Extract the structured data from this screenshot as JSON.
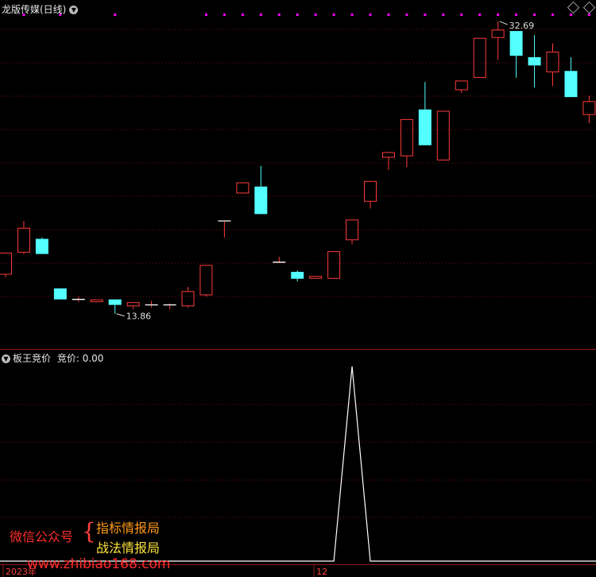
{
  "header": {
    "main_title": "龙版传媒(日线)",
    "sub_title": "板王竞价",
    "sub_value_label": "竞价: 0.00"
  },
  "colors": {
    "up": "#ff3a3a",
    "down": "#54ffff",
    "grid": "#7a1010",
    "marker": "#ff00ff",
    "line": "#ffffff"
  },
  "chart_data": [
    {
      "type": "candlestick",
      "title": "龙版传媒(日线)",
      "ylim": [
        12.4,
        35.5
      ],
      "grid": true,
      "annotations": [
        {
          "label": "13.86",
          "candle_index": 6
        },
        {
          "label": "32.69",
          "candle_index": 27
        }
      ],
      "marker_candle_indices": [
        1,
        3,
        6,
        11,
        12,
        13,
        14,
        15,
        16,
        17,
        18,
        19,
        20,
        21,
        22,
        23,
        24,
        25,
        26,
        27,
        28,
        29,
        30,
        31,
        32
      ],
      "candles": [
        {
          "o": 16.7,
          "c": 18.3,
          "h": 18.3,
          "l": 16.5
        },
        {
          "o": 18.3,
          "c": 20.1,
          "h": 20.6,
          "l": 18.2
        },
        {
          "o": 19.3,
          "c": 18.2,
          "h": 19.4,
          "l": 18.2
        },
        {
          "o": 15.7,
          "c": 14.9,
          "h": 15.7,
          "l": 14.9
        },
        {
          "o": 14.9,
          "c": 14.9,
          "h": 15.1,
          "l": 14.7
        },
        {
          "o": 14.7,
          "c": 14.9,
          "h": 14.9,
          "l": 14.7
        },
        {
          "o": 14.9,
          "c": 14.5,
          "h": 14.9,
          "l": 13.86
        },
        {
          "o": 14.4,
          "c": 14.7,
          "h": 14.7,
          "l": 14.2
        },
        {
          "o": 14.5,
          "c": 14.5,
          "h": 14.8,
          "l": 14.3
        },
        {
          "o": 14.5,
          "c": 14.5,
          "h": 14.6,
          "l": 14.2
        },
        {
          "o": 14.4,
          "c": 15.5,
          "h": 15.8,
          "l": 14.3
        },
        {
          "o": 15.2,
          "c": 17.4,
          "h": 17.4,
          "l": 15.1
        },
        {
          "o": 20.6,
          "c": 20.6,
          "h": 20.6,
          "l": 19.4
        },
        {
          "o": 22.6,
          "c": 23.4,
          "h": 23.4,
          "l": 22.6
        },
        {
          "o": 23.1,
          "c": 21.1,
          "h": 24.6,
          "l": 21.1
        },
        {
          "o": 17.6,
          "c": 17.6,
          "h": 18.0,
          "l": 17.6
        },
        {
          "o": 16.9,
          "c": 16.4,
          "h": 17.0,
          "l": 16.2
        },
        {
          "o": 16.4,
          "c": 16.6,
          "h": 16.6,
          "l": 16.4
        },
        {
          "o": 16.4,
          "c": 18.4,
          "h": 18.4,
          "l": 16.4
        },
        {
          "o": 19.2,
          "c": 20.7,
          "h": 20.7,
          "l": 18.9
        },
        {
          "o": 22.0,
          "c": 23.5,
          "h": 23.5,
          "l": 21.5
        },
        {
          "o": 25.2,
          "c": 25.6,
          "h": 25.6,
          "l": 24.3
        },
        {
          "o": 25.3,
          "c": 28.0,
          "h": 28.0,
          "l": 24.5
        },
        {
          "o": 28.7,
          "c": 26.1,
          "h": 30.7,
          "l": 26.1
        },
        {
          "o": 25.0,
          "c": 28.6,
          "h": 28.6,
          "l": 25.0
        },
        {
          "o": 30.1,
          "c": 30.8,
          "h": 30.8,
          "l": 29.9
        },
        {
          "o": 31.0,
          "c": 33.9,
          "h": 33.9,
          "l": 31.0
        },
        {
          "o": 33.9,
          "c": 34.5,
          "h": 35.1,
          "l": 32.3
        },
        {
          "o": 34.4,
          "c": 32.6,
          "h": 34.2,
          "l": 31.0
        },
        {
          "o": 32.5,
          "c": 31.9,
          "h": 34.1,
          "l": 30.3
        },
        {
          "o": 31.4,
          "c": 32.9,
          "h": 33.5,
          "l": 30.4
        },
        {
          "o": 31.5,
          "c": 29.6,
          "h": 32.5,
          "l": 29.6
        },
        {
          "o": 28.3,
          "c": 29.3,
          "h": 29.7,
          "l": 27.7
        }
      ]
    },
    {
      "type": "line",
      "title": "板王竞价",
      "series_label": "竞价",
      "current_value": "0.00",
      "ylim": [
        0,
        100
      ],
      "values": [
        0,
        0,
        0,
        0,
        0,
        0,
        0,
        0,
        0,
        0,
        0,
        0,
        0,
        0,
        0,
        0,
        0,
        0,
        0,
        100,
        0,
        0,
        0,
        0,
        0,
        0,
        0,
        0,
        0,
        0,
        0,
        0,
        0
      ],
      "x_ticks": [
        {
          "label": "2023年",
          "candle_index": 0
        },
        {
          "label": "12",
          "candle_index": 17
        }
      ]
    }
  ],
  "promo": {
    "left": "微信公众号",
    "brace": "{",
    "line1": "指标情报局",
    "line2": "战法情报局",
    "watermark": "www.zhibiao168.com"
  }
}
